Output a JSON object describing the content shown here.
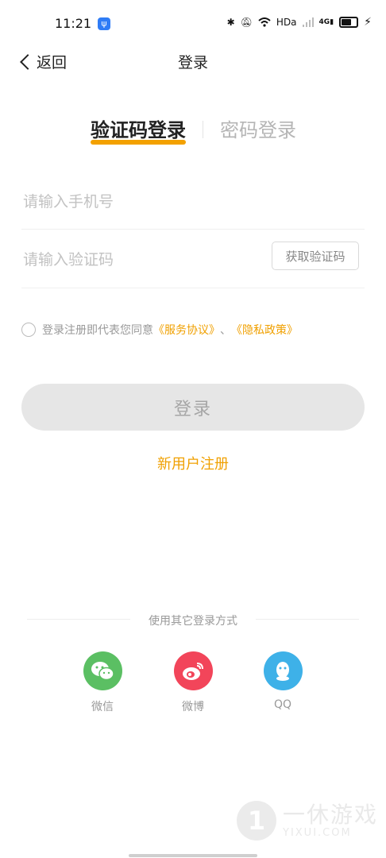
{
  "status_bar": {
    "time": "11:21",
    "network": "HDa",
    "signal": "4G"
  },
  "header": {
    "back_label": "返回",
    "title": "登录"
  },
  "tabs": [
    {
      "label": "验证码登录",
      "active": true
    },
    {
      "label": "密码登录",
      "active": false
    }
  ],
  "form": {
    "phone_placeholder": "请输入手机号",
    "code_placeholder": "请输入验证码",
    "get_code_label": "获取验证码"
  },
  "agreement": {
    "text": "登录注册即代表您同意",
    "service_link": "《服务协议》",
    "separator": "、",
    "privacy_link": "《隐私政策》"
  },
  "login_button": "登录",
  "register_link": "新用户注册",
  "other_login": {
    "label": "使用其它登录方式",
    "options": [
      {
        "label": "微信",
        "icon": "wechat-icon",
        "color": "#5bbf63"
      },
      {
        "label": "微博",
        "icon": "weibo-icon",
        "color": "#f2455a"
      },
      {
        "label": "QQ",
        "icon": "qq-icon",
        "color": "#3eb1e8"
      }
    ]
  },
  "watermark": {
    "cn": "一休游戏",
    "en": "YIXUI.COM",
    "logo": "1"
  },
  "colors": {
    "accent": "#f0a000",
    "tab_underline": "#f3a100",
    "button_bg": "#e6e6e6"
  }
}
